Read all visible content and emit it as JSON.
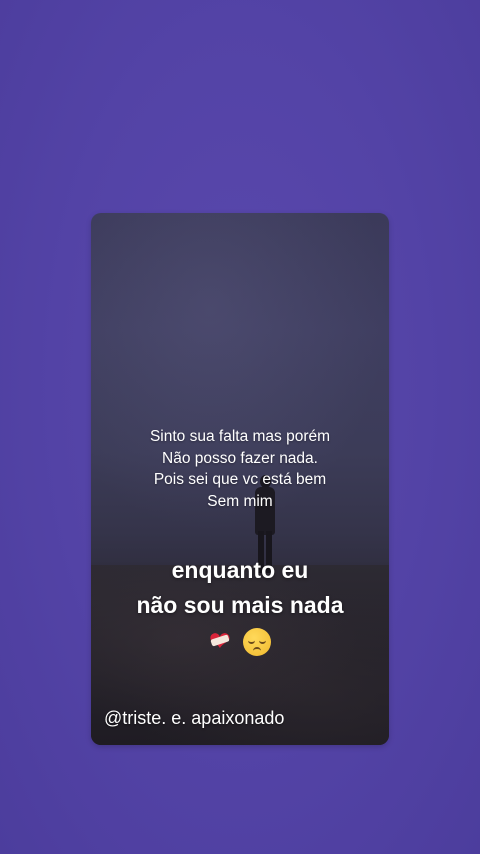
{
  "story": {
    "caption_lines": [
      "Sinto sua falta mas porém",
      "Não posso fazer nada.",
      "Pois sei que vc está bem",
      "Sem mim"
    ],
    "headline_lines": [
      "enquanto eu",
      "não sou mais nada"
    ],
    "emojis": [
      "mending-heart-icon",
      "pensive-face-icon"
    ],
    "handle": "@triste. e. apaixonado"
  },
  "colors": {
    "background": "#5343a6",
    "text": "#ffffff"
  }
}
